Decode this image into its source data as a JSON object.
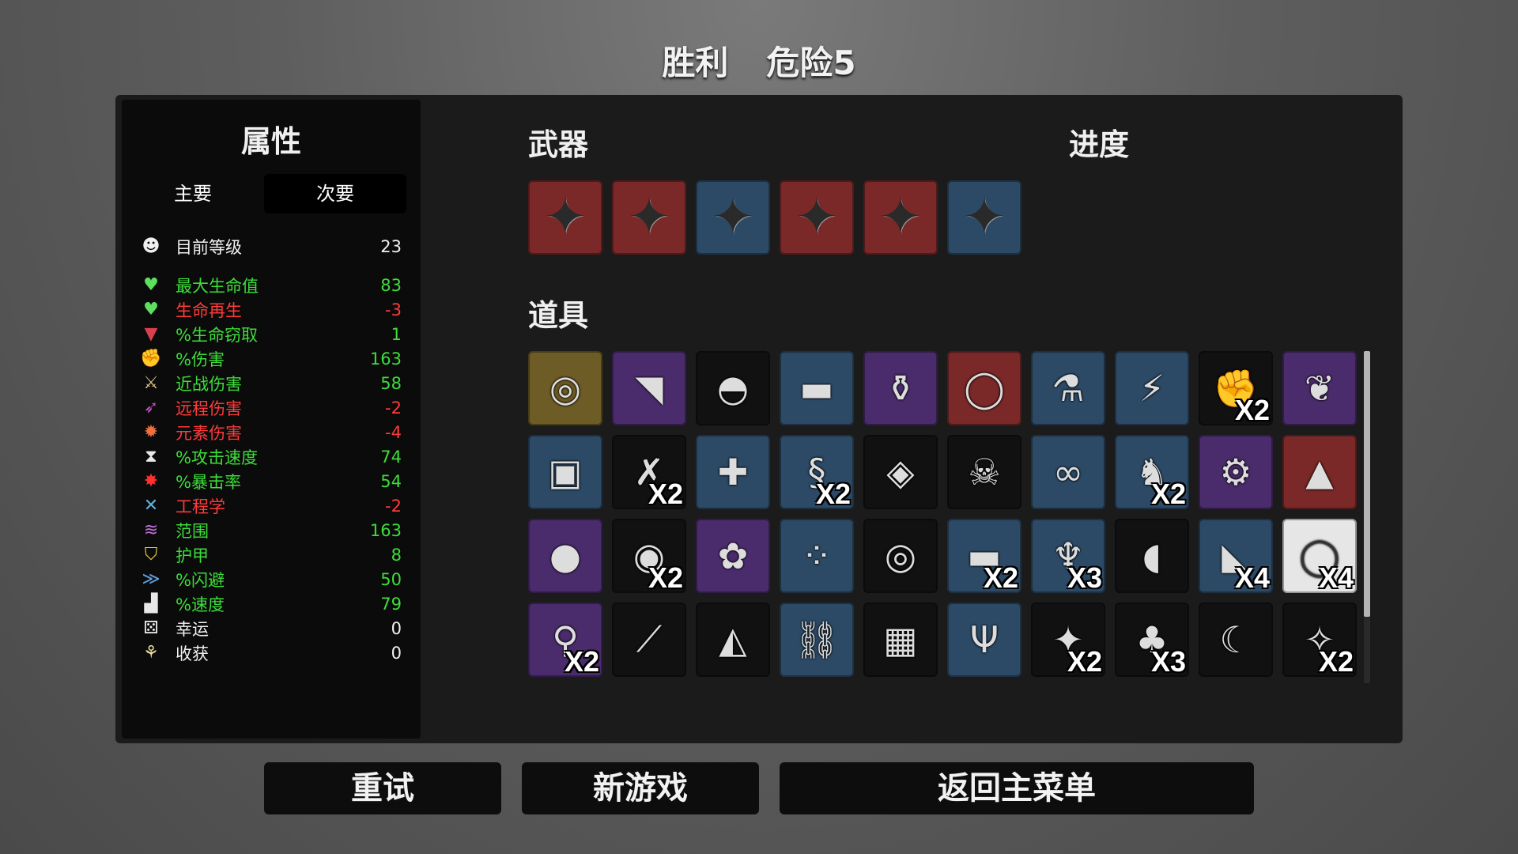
{
  "header": {
    "result": "胜利",
    "danger": "危险5"
  },
  "stats": {
    "title": "属性",
    "tab_primary": "主要",
    "tab_secondary": "次要",
    "rows": [
      {
        "icon": "level-up-icon",
        "glyph": "☻",
        "label": "目前等级",
        "value": "23",
        "color": "white"
      },
      {
        "icon": "heart-icon",
        "glyph": "♥",
        "label": "最大生命值",
        "value": "83",
        "color": "green"
      },
      {
        "icon": "heart-plus-icon",
        "glyph": "♥",
        "label": "生命再生",
        "value": "-3",
        "color": "red"
      },
      {
        "icon": "vampire-fang-icon",
        "glyph": "▼",
        "label": "%生命窃取",
        "value": "1",
        "color": "green"
      },
      {
        "icon": "muscle-icon",
        "glyph": "✊",
        "label": "%伤害",
        "value": "163",
        "color": "green"
      },
      {
        "icon": "sword-icon",
        "glyph": "⚔",
        "label": "近战伤害",
        "value": "58",
        "color": "green"
      },
      {
        "icon": "bow-icon",
        "glyph": "➶",
        "label": "远程伤害",
        "value": "-2",
        "color": "red"
      },
      {
        "icon": "fire-icon",
        "glyph": "✹",
        "label": "元素伤害",
        "value": "-4",
        "color": "red"
      },
      {
        "icon": "hourglass-icon",
        "glyph": "⧗",
        "label": "%攻击速度",
        "value": "74",
        "color": "green"
      },
      {
        "icon": "crit-burst-icon",
        "glyph": "✸",
        "label": "%暴击率",
        "value": "54",
        "color": "green"
      },
      {
        "icon": "wrench-icon",
        "glyph": "✕",
        "label": "工程学",
        "value": "-2",
        "color": "red"
      },
      {
        "icon": "range-wifi-icon",
        "glyph": "≋",
        "label": "范围",
        "value": "163",
        "color": "green"
      },
      {
        "icon": "shield-icon",
        "glyph": "⛉",
        "label": "护甲",
        "value": "8",
        "color": "green"
      },
      {
        "icon": "dodge-icon",
        "glyph": "≫",
        "label": "%闪避",
        "value": "50",
        "color": "green"
      },
      {
        "icon": "boot-icon",
        "glyph": "▟",
        "label": "%速度",
        "value": "79",
        "color": "green"
      },
      {
        "icon": "dice-icon",
        "glyph": "⚄",
        "label": "幸运",
        "value": "0",
        "color": "white"
      },
      {
        "icon": "harvest-wheat-icon",
        "glyph": "⚘",
        "label": "收获",
        "value": "0",
        "color": "white"
      }
    ]
  },
  "weapons": {
    "title": "武器",
    "items": [
      {
        "icon": "shuriken-icon",
        "tier": "red"
      },
      {
        "icon": "shuriken-icon",
        "tier": "red"
      },
      {
        "icon": "shuriken-icon",
        "tier": "blue"
      },
      {
        "icon": "shuriken-icon",
        "tier": "red"
      },
      {
        "icon": "shuriken-icon",
        "tier": "red"
      },
      {
        "icon": "shuriken-icon",
        "tier": "blue"
      }
    ]
  },
  "progress": {
    "title": "进度"
  },
  "items": {
    "title": "道具",
    "rows": [
      [
        {
          "icon": "egg-icon",
          "glyph": "◎",
          "tier": "gold",
          "count": ""
        },
        {
          "icon": "bandana-icon",
          "glyph": "◥",
          "tier": "purple",
          "count": ""
        },
        {
          "icon": "beanie-icon",
          "glyph": "◓",
          "tier": "black",
          "count": ""
        },
        {
          "icon": "sunglasses-icon",
          "glyph": "▬",
          "tier": "blue",
          "count": ""
        },
        {
          "icon": "baby-bottle-icon",
          "glyph": "⚱",
          "tier": "purple",
          "count": ""
        },
        {
          "icon": "ring-icon",
          "glyph": "◯",
          "tier": "red",
          "count": ""
        },
        {
          "icon": "potion-flask-icon",
          "glyph": "⚗",
          "tier": "blue",
          "count": ""
        },
        {
          "icon": "claw-icon",
          "glyph": "⚡",
          "tier": "blue",
          "count": ""
        },
        {
          "icon": "bandaged-fist-icon",
          "glyph": "✊",
          "tier": "black",
          "count": "X2"
        },
        {
          "icon": "wings-icon",
          "glyph": "❦",
          "tier": "purple",
          "count": ""
        }
      ],
      [
        {
          "icon": "turret-icon",
          "glyph": "▣",
          "tier": "blue",
          "count": ""
        },
        {
          "icon": "cross-scar-icon",
          "glyph": "✗",
          "tier": "black",
          "count": "X2"
        },
        {
          "icon": "medic-robot-icon",
          "glyph": "✚",
          "tier": "blue",
          "count": ""
        },
        {
          "icon": "worm-icon",
          "glyph": "§",
          "tier": "blue",
          "count": "X2"
        },
        {
          "icon": "banknote-icon",
          "glyph": "◈",
          "tier": "black",
          "count": ""
        },
        {
          "icon": "ghost-skull-icon",
          "glyph": "☠",
          "tier": "black",
          "count": ""
        },
        {
          "icon": "black-belt-icon",
          "glyph": "∞",
          "tier": "blue",
          "count": ""
        },
        {
          "icon": "rabbit-icon",
          "glyph": "♞",
          "tier": "blue",
          "count": "X2"
        },
        {
          "icon": "alien-tech-icon",
          "glyph": "⚙",
          "tier": "purple",
          "count": ""
        },
        {
          "icon": "cape-icon",
          "glyph": "▲",
          "tier": "red",
          "count": ""
        }
      ],
      [
        {
          "icon": "snail-icon",
          "glyph": "●",
          "tier": "purple",
          "count": ""
        },
        {
          "icon": "owl-mask-icon",
          "glyph": "◉",
          "tier": "black",
          "count": "X2"
        },
        {
          "icon": "brain-icon",
          "glyph": "✿",
          "tier": "purple",
          "count": ""
        },
        {
          "icon": "dots-icon",
          "glyph": "⁘",
          "tier": "blue",
          "count": ""
        },
        {
          "icon": "target-robot-icon",
          "glyph": "◎",
          "tier": "black",
          "count": ""
        },
        {
          "icon": "gray-rock-icon",
          "glyph": "▬",
          "tier": "blue",
          "count": "X2"
        },
        {
          "icon": "cloak-icon",
          "glyph": "♆",
          "tier": "blue",
          "count": "X3"
        },
        {
          "icon": "mouth-icon",
          "glyph": "◖",
          "tier": "black",
          "count": ""
        },
        {
          "icon": "bone-icon",
          "glyph": "◣",
          "tier": "blue",
          "count": "X4"
        },
        {
          "icon": "pendant-icon",
          "glyph": "◯",
          "tier": "white",
          "count": "X4"
        }
      ],
      [
        {
          "icon": "bottle-icon",
          "glyph": "⚲",
          "tier": "purple",
          "count": "X2"
        },
        {
          "icon": "syringe-icon",
          "glyph": "⟋",
          "tier": "black",
          "count": ""
        },
        {
          "icon": "cake-icon",
          "glyph": "◭",
          "tier": "black",
          "count": ""
        },
        {
          "icon": "chain-icon",
          "glyph": "⛓",
          "tier": "blue",
          "count": ""
        },
        {
          "icon": "flannel-shirt-icon",
          "glyph": "▦",
          "tier": "black",
          "count": ""
        },
        {
          "icon": "claw-crab-icon",
          "glyph": "Ψ",
          "tier": "blue",
          "count": ""
        },
        {
          "icon": "teddy-bear-icon",
          "glyph": "✦",
          "tier": "black",
          "count": "X2"
        },
        {
          "icon": "tree-icon",
          "glyph": "♣",
          "tier": "black",
          "count": "X3"
        },
        {
          "icon": "scythe-icon",
          "glyph": "☾",
          "tier": "black",
          "count": ""
        },
        {
          "icon": "wand-icon",
          "glyph": "✧",
          "tier": "black",
          "count": "X2"
        }
      ]
    ]
  },
  "buttons": {
    "retry": "重试",
    "new_game": "新游戏",
    "main_menu": "返回主菜单"
  }
}
